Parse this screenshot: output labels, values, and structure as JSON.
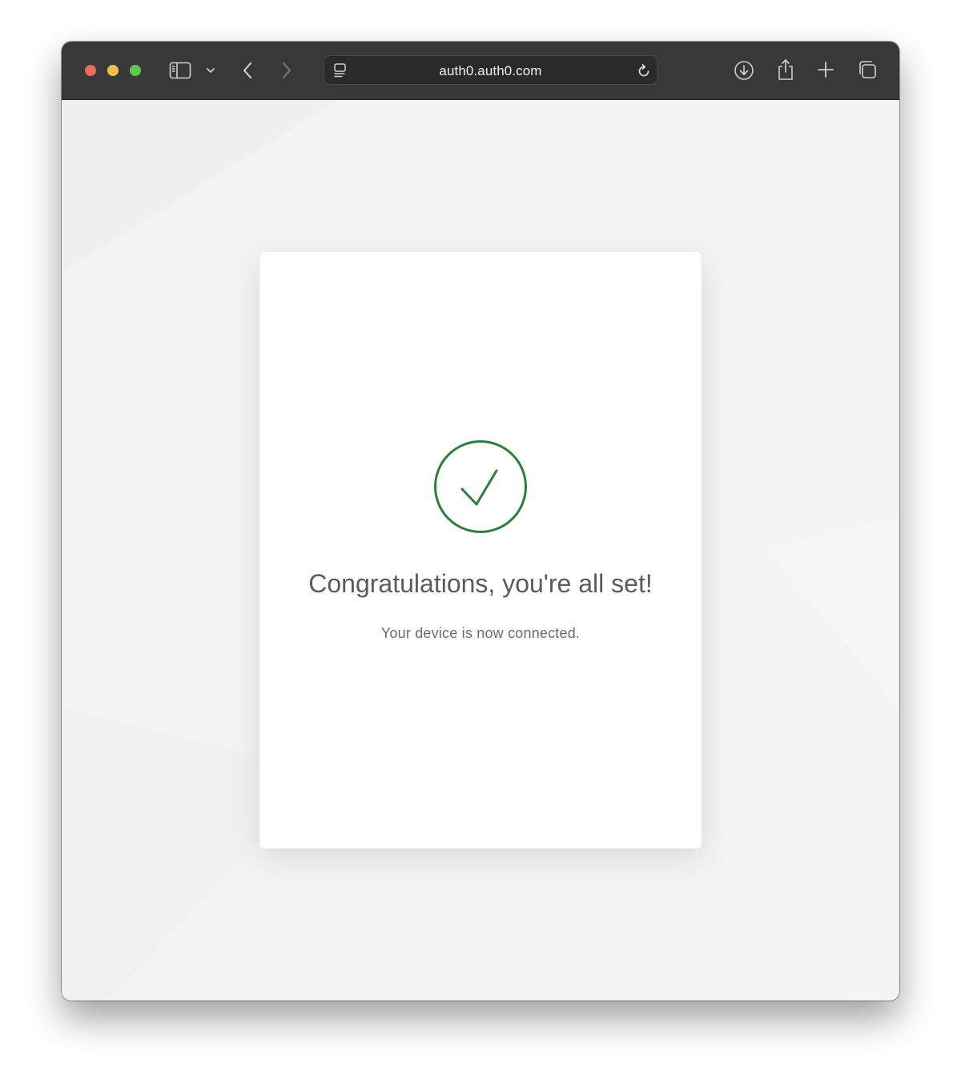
{
  "browser": {
    "address_bar": {
      "url": "auth0.auth0.com"
    },
    "icons": {
      "close": "close-window-icon",
      "minimize": "minimize-window-icon",
      "maximize": "maximize-window-icon",
      "sidebar": "sidebar-icon",
      "tab_groups": "chevron-down-icon",
      "back": "back-arrow-icon",
      "forward": "forward-arrow-icon",
      "site_settings": "page-settings-icon",
      "reload": "reload-icon",
      "downloads": "download-icon",
      "share": "share-icon",
      "new_tab": "plus-icon",
      "tab_overview": "tab-overview-icon"
    },
    "colors": {
      "toolbar": "#383838",
      "close": "#ed6a5e",
      "minimize": "#f5bf4f",
      "maximize": "#61c554"
    }
  },
  "page": {
    "title": "Congratulations, you're all set!",
    "message": "Your device is now connected.",
    "status_icon": "success-check-icon",
    "accent_color": "#2e7d3c"
  }
}
